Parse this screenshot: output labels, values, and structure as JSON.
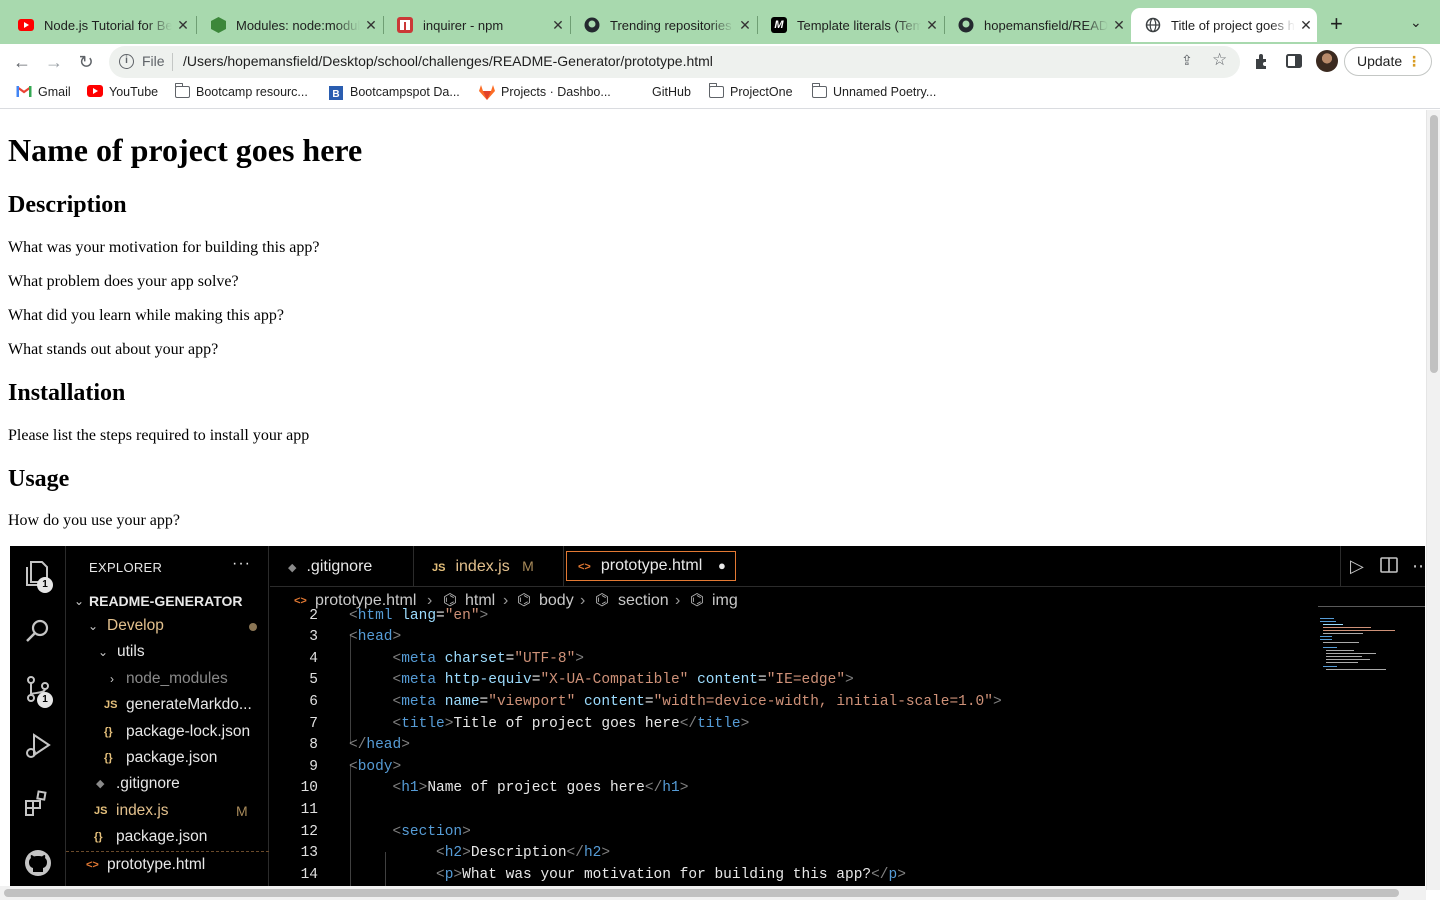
{
  "browser": {
    "tabs": [
      {
        "title": "Node.js Tutorial for Beginners",
        "icon": "youtube-icon"
      },
      {
        "title": "Modules: node:module",
        "icon": "nodejs-icon"
      },
      {
        "title": "inquirer - npm",
        "icon": "npm-icon"
      },
      {
        "title": "Trending repositories",
        "icon": "github-icon"
      },
      {
        "title": "Template literals (Template strings)",
        "icon": "mdn-icon"
      },
      {
        "title": "hopemansfield/README",
        "icon": "github-icon"
      },
      {
        "title": "Title of project goes here",
        "icon": "globe-icon",
        "active": true
      }
    ],
    "address": {
      "scheme": "File",
      "url": "/Users/hopemansfield/Desktop/school/challenges/README-Generator/prototype.html"
    },
    "update_label": "Update",
    "bookmarks": [
      {
        "label": "Gmail",
        "icon": "gmail-icon"
      },
      {
        "label": "YouTube",
        "icon": "youtube-icon"
      },
      {
        "label": "Bootcamp resourc...",
        "icon": "folder-icon"
      },
      {
        "label": "Bootcampspot Da...",
        "icon": "bootcampspot-icon"
      },
      {
        "label": "Projects · Dashbo...",
        "icon": "gitlab-icon"
      },
      {
        "label": "GitHub",
        "icon": "github-icon"
      },
      {
        "label": "ProjectOne",
        "icon": "folder-icon"
      },
      {
        "label": "Unnamed Poetry...",
        "icon": "folder-icon"
      }
    ]
  },
  "page": {
    "h1": "Name of project goes here",
    "sections": [
      {
        "heading": "Description",
        "paragraphs": [
          "What was your motivation for building this app?",
          "What problem does your app solve?",
          "What did you learn while making this app?",
          "What stands out about your app?"
        ]
      },
      {
        "heading": "Installation",
        "paragraphs": [
          "Please list the steps required to install your app"
        ]
      },
      {
        "heading": "Usage",
        "paragraphs": [
          "How do you use your app?"
        ]
      }
    ]
  },
  "vscode": {
    "explorer_title": "EXPLORER",
    "more": "···",
    "badges": {
      "explorer": "1",
      "source_control": "1"
    },
    "tree": [
      {
        "label": "README-GENERATOR",
        "type": "root"
      },
      {
        "label": "Develop",
        "type": "folder",
        "modified_dot": true
      },
      {
        "label": "utils",
        "type": "folder"
      },
      {
        "label": "node_modules",
        "type": "folder-collapsed"
      },
      {
        "label": "generateMarkdo...",
        "type": "js",
        "icon": "JS"
      },
      {
        "label": "package-lock.json",
        "type": "json",
        "icon": "{}"
      },
      {
        "label": "package.json",
        "type": "json",
        "icon": "{}"
      },
      {
        "label": ".gitignore",
        "type": "git",
        "icon": "◆"
      },
      {
        "label": "index.js",
        "type": "js",
        "icon": "JS",
        "status": "M"
      },
      {
        "label": "package.json",
        "type": "json",
        "icon": "{}"
      },
      {
        "label": "prototype.html",
        "type": "html",
        "icon": "<>"
      }
    ],
    "editor_tabs": [
      {
        "label": ".gitignore",
        "icon": "◆"
      },
      {
        "label": "index.js",
        "icon": "JS",
        "status": "M"
      },
      {
        "label": "prototype.html",
        "icon": "<>",
        "active": true,
        "dirty": "●"
      }
    ],
    "breadcrumbs": [
      "prototype.html",
      "html",
      "body",
      "section",
      "img"
    ],
    "code_lines": [
      {
        "n": "2"
      },
      {
        "n": "3"
      },
      {
        "n": "4"
      },
      {
        "n": "5"
      },
      {
        "n": "6"
      },
      {
        "n": "7"
      },
      {
        "n": "8"
      },
      {
        "n": "9"
      },
      {
        "n": "10"
      },
      {
        "n": "11"
      },
      {
        "n": "12"
      },
      {
        "n": "13"
      },
      {
        "n": "14"
      }
    ]
  }
}
